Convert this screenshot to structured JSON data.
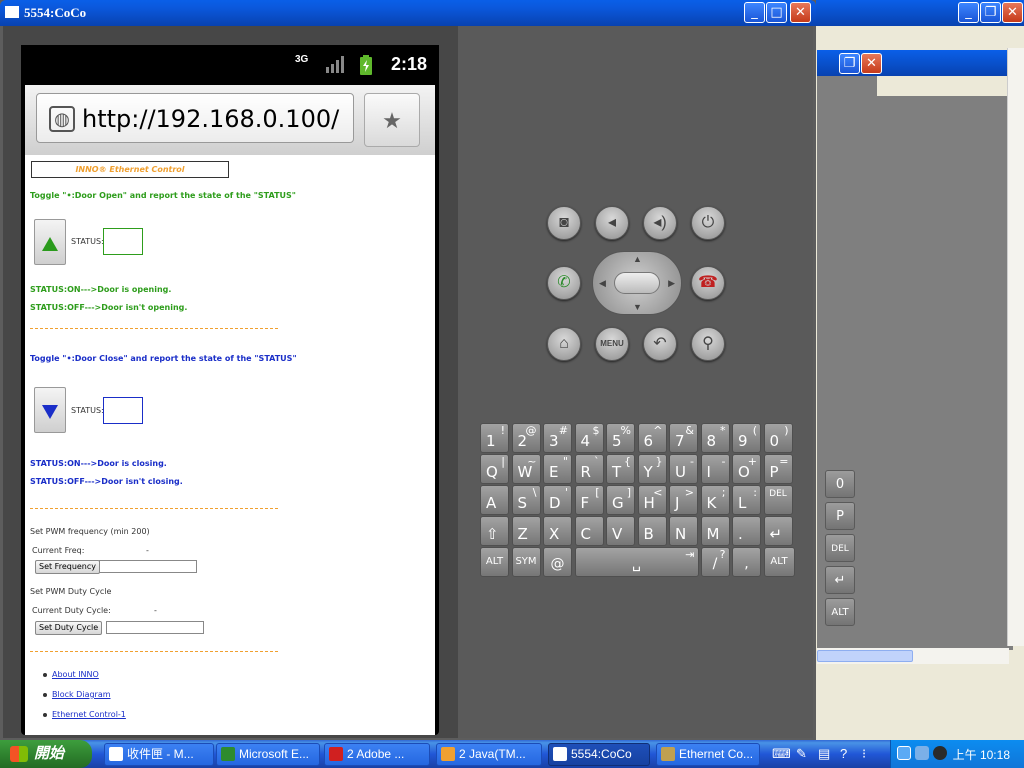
{
  "window": {
    "title": "5554:CoCo",
    "min_icon": "minimize-icon",
    "max_icon": "maximize-icon",
    "close_icon": "close-icon"
  },
  "phone": {
    "status": {
      "network": "3G",
      "time": "2:18"
    },
    "browser": {
      "url": "http://192.168.0.100/",
      "globe_icon": "globe-icon",
      "bookmark_icon": "bookmark-star-icon"
    },
    "page": {
      "header": "INNO® Ethernet Control",
      "open_section": {
        "instruction": "Toggle \"•:Door Open\" and report the state of the \"STATUS\"",
        "status_label": "STATUS:",
        "on_text": "STATUS:ON--->Door is opening.",
        "off_text": "STATUS:OFF--->Door isn't opening."
      },
      "separator": "========================================================",
      "close_section": {
        "instruction": "Toggle \"•:Door Close\" and report the state of the \"STATUS\"",
        "status_label": "STATUS:",
        "on_text": "STATUS:ON--->Door is closing.",
        "off_text": "STATUS:OFF--->Door isn't closing."
      },
      "pwm": {
        "freq_title": "Set PWM frequency (min 200)",
        "current_freq_label": "Current Freq:",
        "current_freq_value": "-",
        "set_freq_button": "Set Frequency",
        "duty_title": "Set PWM Duty Cycle",
        "current_duty_label": "Current Duty Cycle:",
        "current_duty_value": "-",
        "set_duty_button": "Set Duty Cycle"
      },
      "links": [
        "About INNO",
        "Block Diagram",
        "Ethernet Control-1"
      ]
    }
  },
  "controls": {
    "row1": [
      "camera-icon",
      "volume-down-icon",
      "volume-up-icon",
      "power-icon"
    ],
    "row2": [
      "call-icon",
      "dpad",
      "end-call-icon"
    ],
    "row3": [
      "home-icon",
      "MENU",
      "back-icon",
      "search-icon"
    ],
    "menu_label": "MENU"
  },
  "keyboard": {
    "row1": [
      [
        "1",
        "!"
      ],
      [
        "2",
        "@"
      ],
      [
        "3",
        "#"
      ],
      [
        "4",
        "$"
      ],
      [
        "5",
        "%"
      ],
      [
        "6",
        "^"
      ],
      [
        "7",
        "&"
      ],
      [
        "8",
        "*"
      ],
      [
        "9",
        "("
      ],
      [
        "0",
        ")"
      ]
    ],
    "row2": [
      [
        "Q",
        "|"
      ],
      [
        "W",
        "~"
      ],
      [
        "E",
        "\""
      ],
      [
        "R",
        "`"
      ],
      [
        "T",
        "{"
      ],
      [
        "Y",
        "}"
      ],
      [
        "U",
        "-"
      ],
      [
        "I",
        "-"
      ],
      [
        "O",
        "+"
      ],
      [
        "P",
        "="
      ]
    ],
    "row3": [
      [
        "A",
        ""
      ],
      [
        "S",
        "\\"
      ],
      [
        "D",
        "'"
      ],
      [
        "F",
        "["
      ],
      [
        "G",
        "]"
      ],
      [
        "H",
        "<"
      ],
      [
        "J",
        ">"
      ],
      [
        "K",
        ";"
      ],
      [
        "L",
        ":"
      ],
      [
        "DEL",
        ""
      ]
    ],
    "row4": [
      [
        "⇧",
        ""
      ],
      [
        "Z",
        ""
      ],
      [
        "X",
        ""
      ],
      [
        "C",
        ""
      ],
      [
        "V",
        ""
      ],
      [
        "B",
        ""
      ],
      [
        "N",
        ""
      ],
      [
        "M",
        ""
      ],
      [
        ".",
        ""
      ],
      [
        "↵",
        ""
      ]
    ],
    "row5": {
      "alt_left": "ALT",
      "sym": "SYM",
      "at": "@",
      "space": "␣",
      "tab": "⇥",
      "slash": "/",
      "question": "?",
      "comma": ",",
      "alt_right": "ALT"
    }
  },
  "side_keys": {
    "zero": "0",
    "paren_l": "(",
    "paren_r": ")",
    "p": "P",
    "eq": "=",
    "del": "DEL",
    "enter": "↵",
    "alt": "ALT"
  },
  "taskbar": {
    "start": "開始",
    "tasks": [
      "收件匣 - M...",
      "Microsoft E...",
      "2 Adobe ...",
      "2 Java(TM...",
      "5554:CoCo",
      "Ethernet Co..."
    ],
    "active_task": "5554:CoCo",
    "clock": "上午 10:18"
  },
  "colors": {
    "green": "#2e9d1c",
    "blue": "#1a2ec8",
    "xp_blue": "#0842b0",
    "separator": "#f0a030"
  }
}
